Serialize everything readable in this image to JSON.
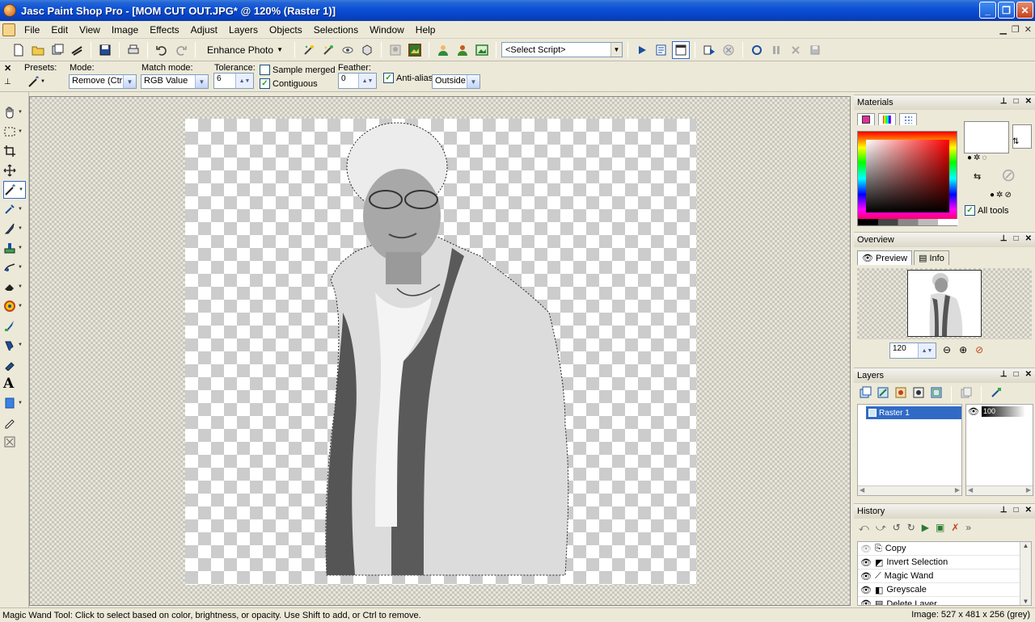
{
  "window": {
    "title": "Jasc Paint Shop Pro - [MOM CUT OUT.JPG* @ 120% (Raster 1)]",
    "minimize": "_",
    "maximize": "❐",
    "close": "✕"
  },
  "menu": {
    "items": [
      "File",
      "Edit",
      "View",
      "Image",
      "Effects",
      "Adjust",
      "Layers",
      "Objects",
      "Selections",
      "Window",
      "Help"
    ]
  },
  "toolbar": {
    "enhance_photo": "Enhance Photo",
    "select_script": "<Select Script>"
  },
  "tool_options": {
    "presets_label": "Presets:",
    "mode_label": "Mode:",
    "mode_value": "Remove (Ctrl)",
    "match_mode_label": "Match mode:",
    "match_mode_value": "RGB Value",
    "tolerance_label": "Tolerance:",
    "tolerance_value": "6",
    "sample_merged": "Sample merged",
    "sample_merged_checked": false,
    "contiguous": "Contiguous",
    "contiguous_checked": true,
    "feather_label": "Feather:",
    "feather_value": "0",
    "anti_alias": "Anti-alias",
    "anti_alias_checked": true,
    "anti_alias_mode": "Outside"
  },
  "panels": {
    "materials": {
      "title": "Materials",
      "all_tools": "All tools"
    },
    "overview": {
      "title": "Overview",
      "tab_preview": "Preview",
      "tab_info": "Info",
      "zoom_value": "120"
    },
    "layers": {
      "title": "Layers",
      "layer_name": "Raster 1",
      "opacity": "100"
    },
    "history": {
      "title": "History",
      "items": [
        "Copy",
        "Invert Selection",
        "Magic Wand",
        "Greyscale",
        "Delete Layer"
      ]
    }
  },
  "status": {
    "hint": "Magic Wand Tool: Click to select based on color, brightness, or opacity. Use Shift to add, or Ctrl to remove.",
    "image_info": "Image:  527 x 481 x 256 (grey)"
  },
  "colors": {
    "titlebar": "#0a4fd6",
    "selected_layer": "#316ac5",
    "chrome": "#ece9d8"
  }
}
